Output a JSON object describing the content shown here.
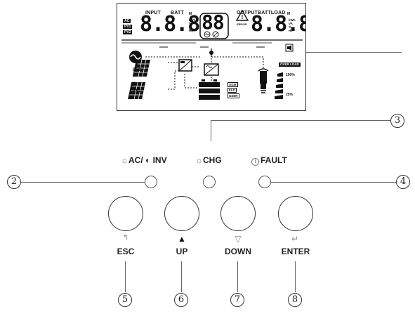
{
  "lcd": {
    "input_label": "INPUT",
    "batt_label": "BATT",
    "output_label": "OUTPUTBATTLOAD",
    "m_label": "M",
    "m_label_right": "M",
    "unit_labels_left": [
      "kWh",
      "VA",
      "%",
      "Hz"
    ],
    "unit_labels_right": [
      "kWh",
      "VA",
      "%",
      "Hz"
    ],
    "source_tags": [
      "AC",
      "PV1",
      "PV2"
    ],
    "left_digits": "8.8.8",
    "center_digits": "88",
    "right_digits": "8.8.8",
    "error_label": "ERROR",
    "pv2_label": "PV2",
    "pv1_label": "PV1",
    "overload_label": "OVER LOAD",
    "battery_types": [
      "AGM",
      "FLD",
      "USER"
    ],
    "load_pct_high": "100%",
    "load_pct_low": "25%"
  },
  "leds": {
    "acinv_label": "AC/ ◐ INV",
    "chg_label": "CHG",
    "fault_label": "FAULT",
    "acinv_icon": "☼",
    "chg_icon": "☼",
    "fault_icon": "!"
  },
  "buttons": {
    "esc_label": "ESC",
    "up_label": "UP",
    "down_label": "DOWN",
    "enter_label": "ENTER",
    "esc_icon": "↰",
    "up_icon": "▲",
    "down_icon": "▽",
    "enter_icon": "↵"
  },
  "callouts": {
    "c2": "②",
    "c3": "③",
    "c4": "④",
    "c5": "⑤",
    "c6": "⑥",
    "c7": "⑦",
    "c8": "⑧"
  }
}
